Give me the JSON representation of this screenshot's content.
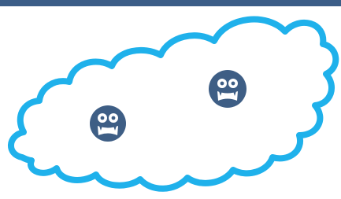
{
  "colors": {
    "top_bar": "#3b5d87",
    "cloud_stroke": "#1fb1eb",
    "cloud_fill": "#ffffff",
    "mascot_face": "#3e5e85",
    "mascot_features": "#ffffff",
    "background": "#ffffff"
  },
  "illustration": {
    "shape": "cloud-outline",
    "mascots": [
      {
        "name": "mascot-left",
        "icon": "monster-face-icon"
      },
      {
        "name": "mascot-right",
        "icon": "monster-face-icon"
      }
    ]
  }
}
